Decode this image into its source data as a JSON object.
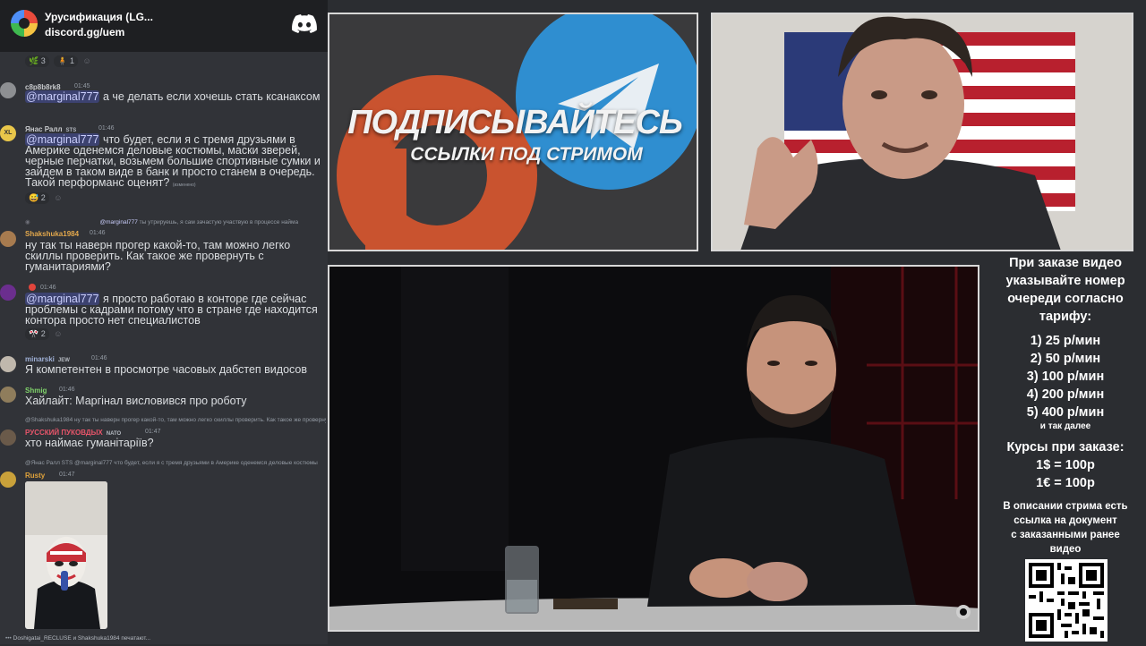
{
  "server": {
    "name": "Урусификация (LG...",
    "invite": "discord.gg/uem"
  },
  "messages": [
    {
      "reactions": [
        "3",
        "1"
      ]
    },
    {
      "user": "c8p8b8rk8",
      "time": "01:45",
      "mention": "@marginal777",
      "text": " а че делать если хочешь стать ксанаксом"
    },
    {
      "user": "Янас Ралл",
      "badge": "STS",
      "time": "01:46",
      "mention": "@marginal777",
      "text": " что будет, если я с тремя друзьями в Америке оденемся  деловые костюмы, маски зверей, черные перчатки, возьмем большие спортивные сумки и зайдем в таком виде в банк и просто станем в очередь. Такой перформанс оценят?",
      "edited": "(изменено)",
      "reactions": [
        "2"
      ]
    },
    {
      "reply_mention": "@marginal777",
      "reply": " ты утрируешь, я сам зачастую участвую в процессе найма",
      "user": "Shakshuka1984",
      "time": "01:46",
      "text": "ну так ты наверн прогер какой-то, там можно легко скиллы проверить. Как такое же провернуть с гуманитариями?"
    },
    {
      "time": "01:46",
      "mention": "@marginal777",
      "text": " я просто работаю в конторе где сейчас проблемы с кадрами потому что в стране где находится контора просто нет специалистов",
      "reactions": [
        "2"
      ]
    },
    {
      "user": "minarski",
      "badge": "JEW",
      "time": "01:46",
      "text": "Я компетентен в просмотре часовых дабстеп видосов"
    },
    {
      "user": "Shmig",
      "time": "01:46",
      "text": "Хайлайт: Маргінал висловився про роботу"
    },
    {
      "reply": "@Shakshuka1984 ну так ты наверн прогер какой-то, там можно легко скиллы проверить. Как такое же провернуть",
      "user": "РУССКИЙ ПУКОВДЫХ",
      "badge": "NATO",
      "time": "01:47",
      "text": "хто наймає гуманітаріїв?"
    },
    {
      "reply": "@Янас Ралл  STS  @marginal777 что будет, если я с тремя друзьями в Америке оденемся  деловые костюмы",
      "user": "Rusty",
      "time": "01:47"
    }
  ],
  "typing": "Doshigatai_RECLUSE и Shakshuka1984 печатают...",
  "promo": {
    "title": "ПОДПИСЫВАЙТЕСЬ",
    "subtitle": "ССЫЛКИ ПОД СТРИМОМ"
  },
  "info": {
    "order_lines": [
      "При заказе видео",
      "указывайте номер",
      "очереди согласно",
      "тарифу:"
    ],
    "tariffs": [
      "1) 25 р/мин",
      "2) 50 р/мин",
      "3) 100 р/мин",
      "4) 200 р/мин",
      "5) 400 р/мин"
    ],
    "tariffs_more": "и так далее",
    "rates_title": "Курсы при заказе:",
    "rates": [
      "1$ = 100р",
      "1€ = 100р"
    ],
    "desc_lines": [
      "В описании стрима есть",
      "ссылка на документ",
      "с заказанными ранее",
      "видео"
    ]
  },
  "colors": {
    "mention_bg": "#3c4270",
    "chat_bg": "#313338",
    "header_bg": "#1e1f22",
    "video_bg": "#0b0b0d"
  }
}
